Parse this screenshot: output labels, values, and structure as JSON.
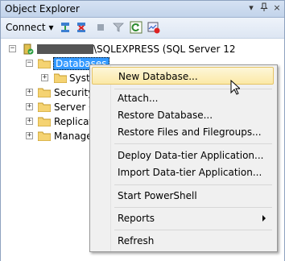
{
  "window": {
    "title": "Object Explorer",
    "pin_glyph": "↓ ȧ",
    "close_glyph": "×"
  },
  "toolbar": {
    "connect_label": "Connect",
    "connect_arrow": "▾",
    "icons": [
      "connect-icon",
      "disconnect-icon",
      "stop-icon",
      "filter-icon",
      "refresh-icon",
      "activity-icon"
    ]
  },
  "tree": {
    "server_suffix": "\\SQLEXPRESS (SQL Server 12",
    "items": [
      {
        "label": "Databases"
      },
      {
        "label": "Syste"
      },
      {
        "label": "Security"
      },
      {
        "label": "Server O"
      },
      {
        "label": "Replicat"
      },
      {
        "label": "Manage"
      }
    ],
    "expand_glyph": "+",
    "collapse_glyph": "−"
  },
  "context_menu": {
    "items": [
      {
        "label": "New Database...",
        "highlighted": true
      },
      {
        "label": "Attach..."
      },
      {
        "label": "Restore Database..."
      },
      {
        "label": "Restore Files and Filegroups..."
      },
      {
        "label": "Deploy Data-tier Application..."
      },
      {
        "label": "Import Data-tier Application..."
      },
      {
        "label": "Start PowerShell"
      },
      {
        "label": "Reports",
        "submenu": true
      },
      {
        "label": "Refresh"
      }
    ]
  },
  "colors": {
    "selection": "#3399ff",
    "menu_hover": "#fbe9a6",
    "titlebar": "#c2d3ea"
  }
}
